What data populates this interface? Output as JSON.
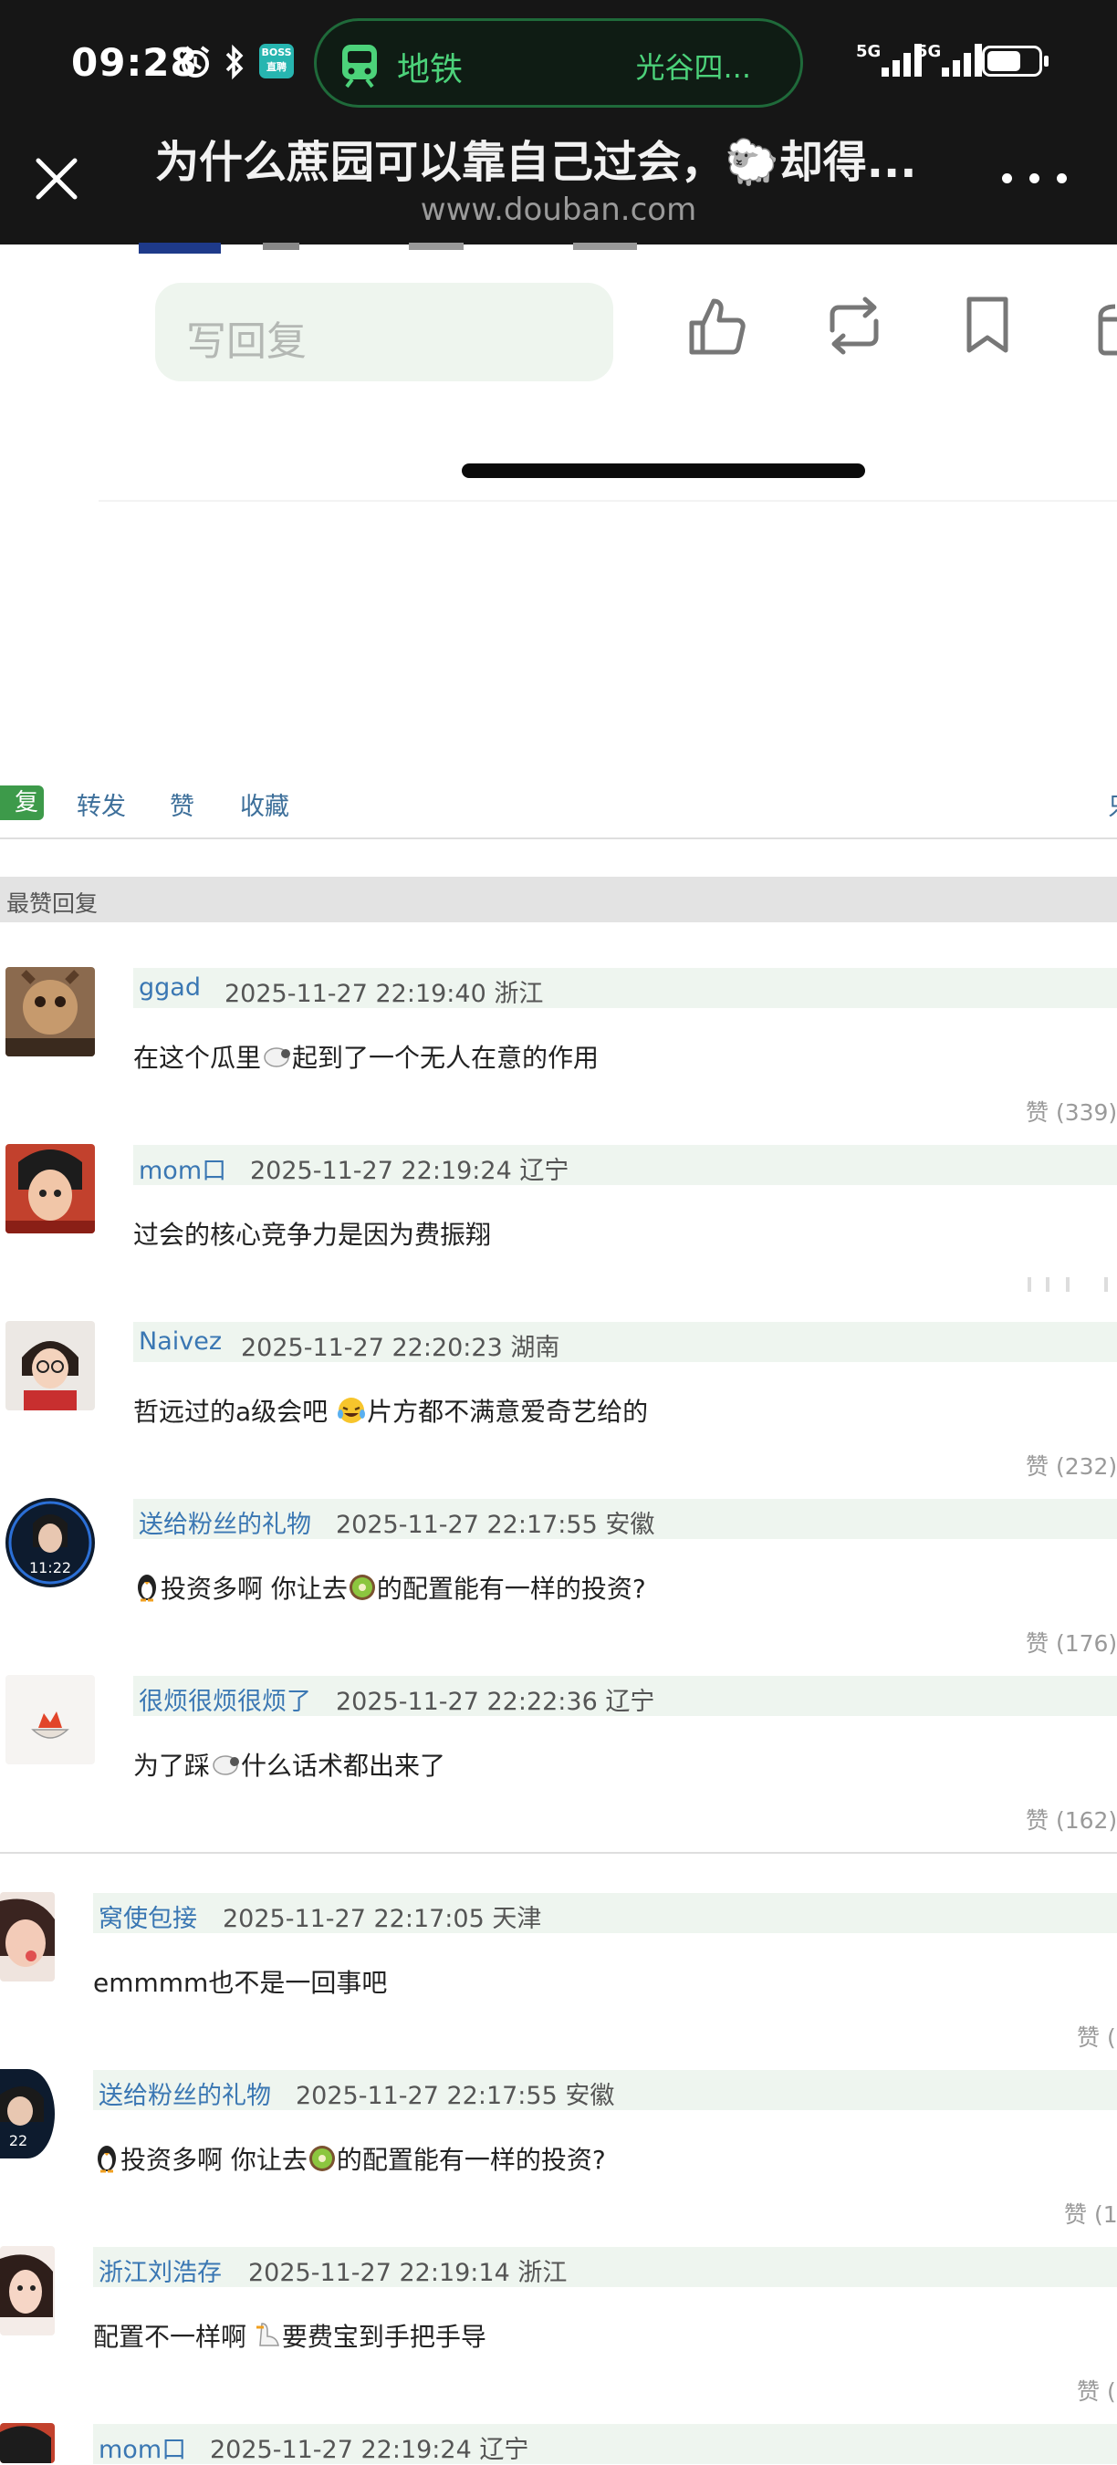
{
  "status_bar": {
    "time": "09:28",
    "boss_badge_line1": "BOSS",
    "boss_badge_line2": "直聘",
    "metro_label": "地铁",
    "metro_destination": "光谷四...",
    "network1": "5G",
    "network2": "5G"
  },
  "header": {
    "title": "为什么蔗园可以靠自己过会，🐑却得...",
    "url": "www.douban.com"
  },
  "reply_bar": {
    "placeholder": "写回复"
  },
  "action_row": {
    "reply_chip": "复",
    "forward": "转发",
    "like": "赞",
    "collect": "收藏",
    "right_cut": "只"
  },
  "hot_replies": {
    "header": "最赞回复",
    "items": [
      {
        "user": "ggad",
        "time": "2025-11-27 22:19:40 浙江",
        "text_a": "在这个瓜里",
        "text_b": "起到了一个无人在意的作用",
        "likes": "赞 (339)"
      },
      {
        "user": "mom口",
        "time": "2025-11-27 22:19:24 辽宁",
        "text_a": "过会的核心竞争力是因为费振翔",
        "text_b": "",
        "likes": ""
      },
      {
        "user": "Naivez",
        "time": "2025-11-27 22:20:23 湖南",
        "text_a": "哲远过的a级会吧 ",
        "text_b": "片方都不满意爱奇艺给的",
        "likes": "赞 (232)"
      },
      {
        "user": "送给粉丝的礼物",
        "time": "2025-11-27 22:17:55 安徽",
        "text_a": "投资多啊 你让去",
        "text_b": "的配置能有一样的投资?",
        "likes": "赞 (176)"
      },
      {
        "user": "很烦很烦很烦了",
        "time": "2025-11-27 22:22:36 辽宁",
        "text_a": "为了踩",
        "text_b": "什么话术都出来了",
        "likes": "赞 (162)"
      }
    ]
  },
  "replies": [
    {
      "user": "窝使包接",
      "time": "2025-11-27 22:17:05 天津",
      "text_a": "emmmm也不是一回事吧",
      "text_b": "",
      "likes": "赞 ("
    },
    {
      "user": "送给粉丝的礼物",
      "time": "2025-11-27 22:17:55 安徽",
      "text_a": "投资多啊 你让去",
      "text_b": "的配置能有一样的投资?",
      "likes": "赞 (1"
    },
    {
      "user": "浙江刘浩存",
      "time": "2025-11-27 22:19:14 浙江",
      "text_a": "配置不一样啊 ",
      "text_b": "要费宝到手把手导",
      "likes": "赞 ("
    },
    {
      "user": "mom口",
      "time": "2025-11-27 22:19:24 辽宁",
      "text_a": "",
      "text_b": "",
      "likes": ""
    }
  ],
  "colors": {
    "link_blue": "#3a77b3",
    "meta_bg": "#eef5ef",
    "reply_green": "#3d9a4a",
    "metro_green": "#4cd27a"
  }
}
